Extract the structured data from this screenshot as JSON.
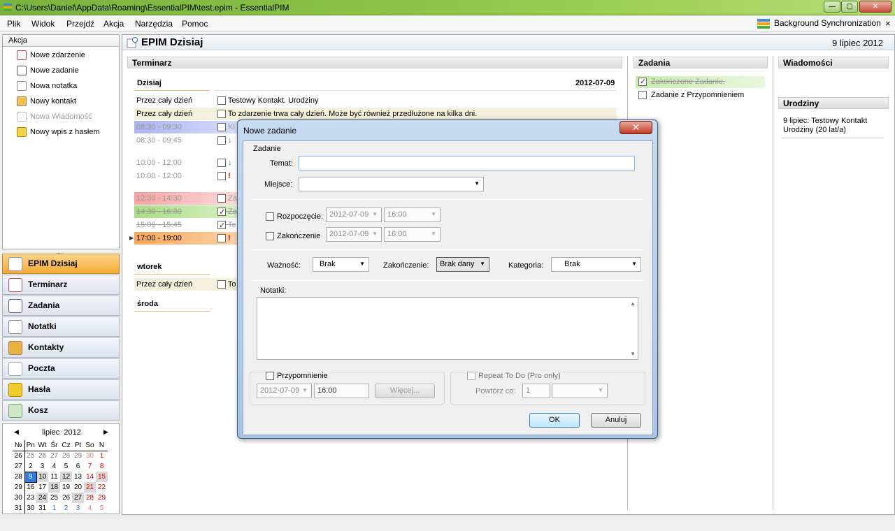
{
  "window": {
    "title": "C:\\Users\\Daniel\\AppData\\Roaming\\EssentialPIM\\test.epim - EssentialPIM",
    "min": "—",
    "max": "▢",
    "close": "✕"
  },
  "menu": [
    "Plik",
    "Widok",
    "Przejdź",
    "Akcja",
    "Narzędzia",
    "Pomoc"
  ],
  "sync": {
    "label": "Background Synchronization",
    "close": "×"
  },
  "akcja": {
    "header": "Akcja",
    "items": [
      "Nowe zdarzenie",
      "Nowe zadanie",
      "Nowa notatka",
      "Nowy kontakt",
      "Nowa Wiadomość",
      "Nowy wpis z hasłem"
    ]
  },
  "nav": [
    "EPIM Dzisiaj",
    "Terminarz",
    "Zadania",
    "Notatki",
    "Kontakty",
    "Poczta",
    "Hasła",
    "Kosz"
  ],
  "calendar": {
    "month": "lipiec",
    "year": "2012",
    "headers": [
      "№",
      "Pn",
      "Wt",
      "Śr",
      "Cz",
      "Pt",
      "So",
      "N"
    ],
    "weeks": [
      [
        "26",
        "25",
        "26",
        "27",
        "28",
        "29",
        "30",
        "1"
      ],
      [
        "27",
        "2",
        "3",
        "4",
        "5",
        "6",
        "7",
        "8"
      ],
      [
        "28",
        "9",
        "10",
        "11",
        "12",
        "13",
        "14",
        "15"
      ],
      [
        "29",
        "16",
        "17",
        "18",
        "19",
        "20",
        "21",
        "22"
      ],
      [
        "30",
        "23",
        "24",
        "25",
        "26",
        "27",
        "28",
        "29"
      ],
      [
        "31",
        "30",
        "31",
        "1",
        "2",
        "3",
        "4",
        "5"
      ]
    ],
    "prev": "◀",
    "next": "▶"
  },
  "main": {
    "title": "EPIM Dzisiaj",
    "date": "9 lipiec 2012",
    "terminarz": "Terminarz",
    "zadania": "Zadania",
    "wiadomosci": "Wiadomości",
    "urodziny": "Urodziny",
    "today": "Dzisiaj",
    "today_date": "2012-07-09",
    "rows": [
      {
        "time": "Przez cały dzień",
        "text": "Testowy Kontakt. Urodziny"
      },
      {
        "time": "Przez cały dzień",
        "text": "To zdarzenie trwa cały dzień. Może być również przedłużone na kilka dni."
      },
      {
        "time": "08:30 - 09:30",
        "text": "Kl"
      },
      {
        "time": "08:30 - 09:45",
        "text": "↓"
      },
      {
        "time": "10:00 - 12:00",
        "text": "↓"
      },
      {
        "time": "10:00 - 12:00",
        "text": "!"
      },
      {
        "time": "12:30 - 14:30",
        "text": "Za"
      },
      {
        "time": "14:30 - 16:30",
        "text": "Za"
      },
      {
        "time": "15:00 - 15:45",
        "text": "Te"
      },
      {
        "time": "17:00 - 19:00",
        "text": "!"
      }
    ],
    "tuesday": "wtorek",
    "tue_row": {
      "time": "Przez cały dzień",
      "text": "To"
    },
    "wednesday": "środa",
    "tasks": [
      "Zakończone Zadanie.",
      "Zadanie z Przypomnieniem"
    ],
    "birthday": "9 lipiec:  Testowy Kontakt\nUrodziny  (20 lat/a)",
    "birthday_line1": "9 lipiec:  Testowy Kontakt",
    "birthday_line2": "Urodziny  (20 lat/a)"
  },
  "dialog": {
    "title": "Nowe zadanie",
    "group_task": "Zadanie",
    "temat_label": "Temat:",
    "temat_value": "",
    "miejsce_label": "Miejsce:",
    "miejsce_value": "",
    "start_label": "Rozpoczęcie:",
    "start_date": "2012-07-09",
    "start_time": "16:00",
    "end_label": "Zakończenie",
    "end_date": "2012-07-09",
    "end_time": "16:00",
    "waznosc_label": "Ważność:",
    "waznosc_value": "Brak",
    "zak_label": "Zakończenie:",
    "zak_value": "Brak dany",
    "kategoria_label": "Kategoria:",
    "kategoria_value": "Brak",
    "notatki_label": "Notatki:",
    "reminder_label": "Przypomnienie",
    "reminder_date": "2012-07-09",
    "reminder_time": "16:00",
    "more": "Więcej...",
    "repeat_label": "Repeat To Do (Pro only)",
    "repeat_every": "Powtórz co:",
    "repeat_value": "1",
    "ok": "OK",
    "cancel": "Anuluj"
  }
}
